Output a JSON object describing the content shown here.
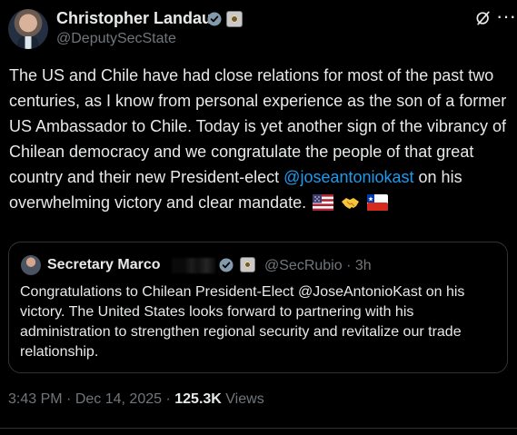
{
  "tweet": {
    "author_name": "Christopher Landau",
    "author_handle": "@DeputySecState",
    "body_before_mention": "The US and Chile have had close relations for most of the past two centuries, as I know from personal experience as the son of a former US Ambassador to Chile. Today is yet another sign of the vibrancy of Chilean democracy and we congratulate the people of that great country and their new President-elect ",
    "mention": "@joseantoniokast",
    "body_after_mention": " on his overwhelming victory and clear mandate.",
    "emojis": [
      "us-flag-icon",
      "handshake-icon",
      "chile-flag-icon"
    ],
    "icons": {
      "verified": "verified-check-icon",
      "government": "government-seal-icon",
      "grok": "grok-icon",
      "more": "more-icon"
    },
    "accent_color": "#1d9bf0"
  },
  "quote": {
    "author_name": "Secretary Marco",
    "author_handle": "@SecRubio",
    "time": "3h",
    "body": "Congratulations to Chilean President-Elect @JoseAntonioKast on his victory. The United States looks forward to partnering with his administration to strengthen regional security and revitalize our trade relationship."
  },
  "footer": {
    "time": "3:43 PM",
    "date": "Dec 14, 2025",
    "views_count": "125.3K",
    "views_label": "Views"
  }
}
